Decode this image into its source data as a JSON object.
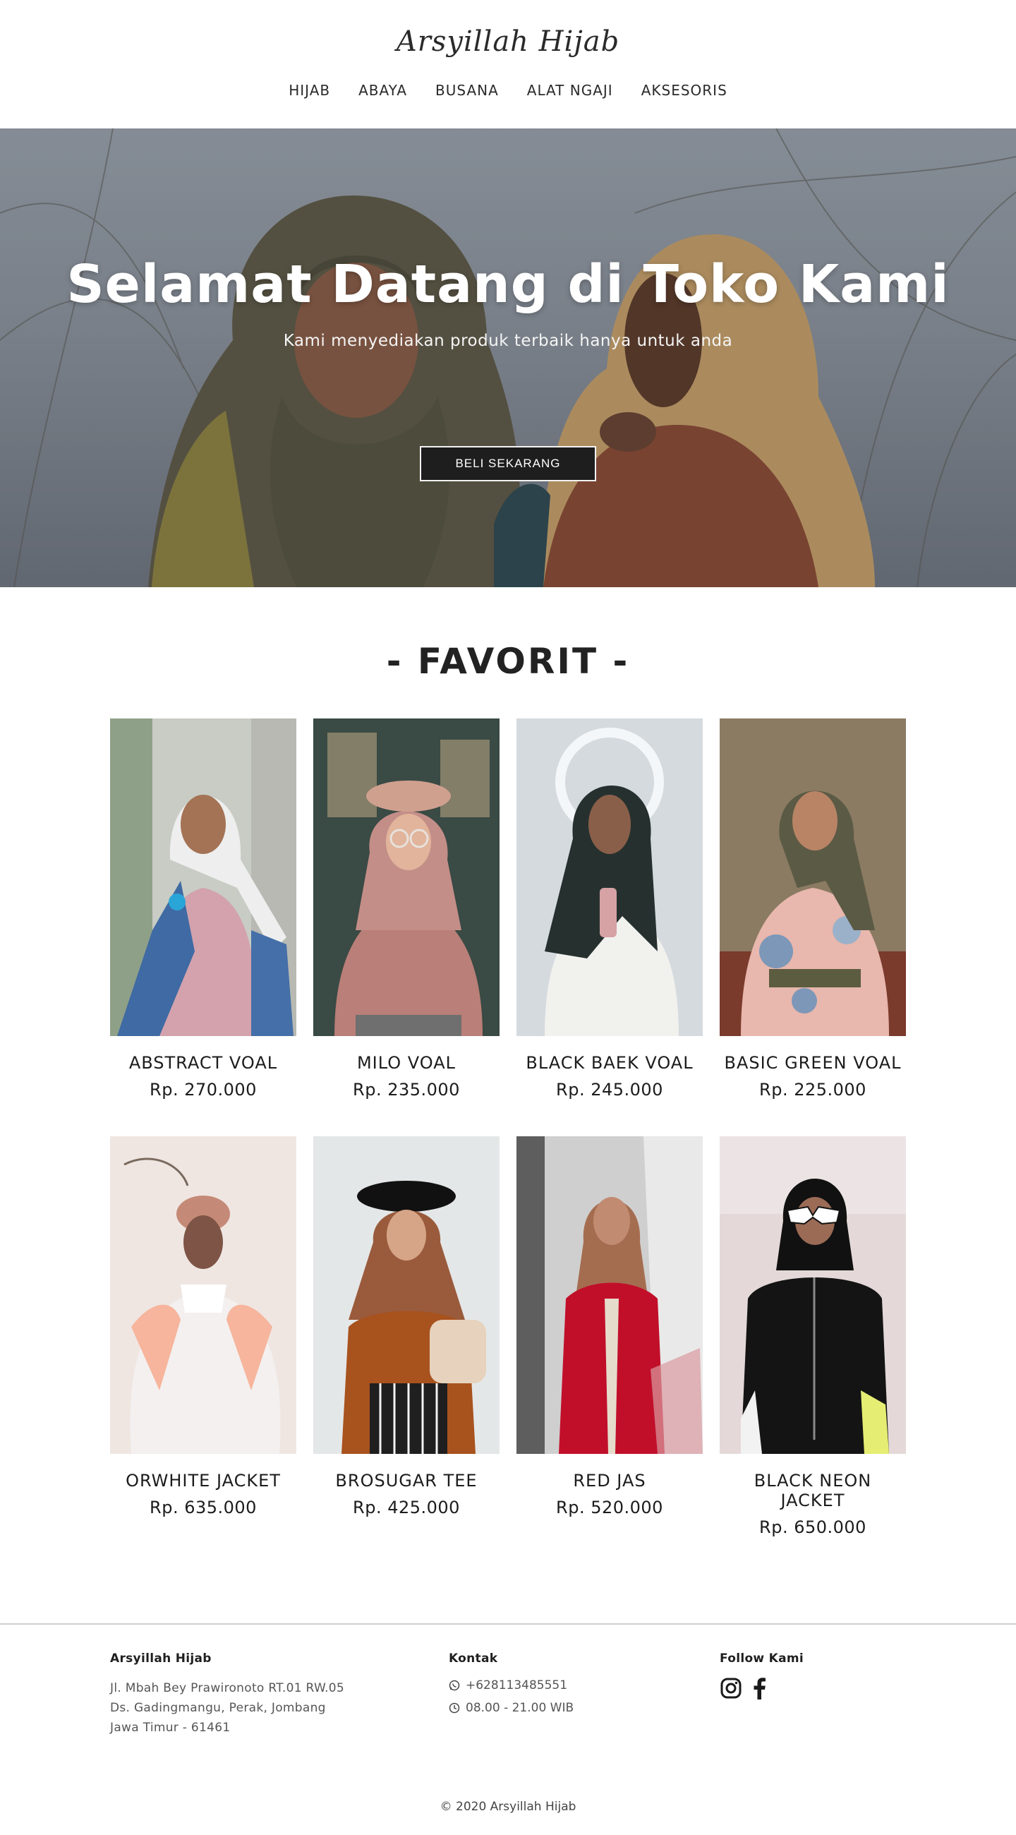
{
  "header": {
    "logo": "Arsyillah Hijab",
    "nav": [
      "HIJAB",
      "ABAYA",
      "BUSANA",
      "ALAT NGAJI",
      "AKSESORIS"
    ]
  },
  "hero": {
    "title": "Selamat Datang di Toko Kami",
    "subtitle": "Kami menyediakan produk terbaik hanya untuk anda",
    "button": "BELI SEKARANG"
  },
  "favorites": {
    "title": "- FAVORIT -",
    "products": [
      {
        "name": "ABSTRACT VOAL",
        "price": "Rp. 270.000"
      },
      {
        "name": "MILO VOAL",
        "price": "Rp. 235.000"
      },
      {
        "name": "BLACK BAEK VOAL",
        "price": "Rp. 245.000"
      },
      {
        "name": "BASIC GREEN VOAL",
        "price": "Rp. 225.000"
      },
      {
        "name": "ORWHITE JACKET",
        "price": "Rp. 635.000"
      },
      {
        "name": "BROSUGAR TEE",
        "price": "Rp. 425.000"
      },
      {
        "name": "RED JAS",
        "price": "Rp. 520.000"
      },
      {
        "name": "BLACK NEON JACKET",
        "price": "Rp. 650.000"
      }
    ]
  },
  "footer": {
    "store": {
      "title": "Arsyillah Hijab",
      "address": [
        "Jl. Mbah Bey Prawironoto RT.01 RW.05",
        "Ds. Gadingmangu, Perak, Jombang",
        "Jawa Timur - 61461"
      ]
    },
    "contact": {
      "title": "Kontak",
      "phone": "+628113485551",
      "hours": "08.00 - 21.00 WIB"
    },
    "follow": {
      "title": "Follow Kami",
      "icons": [
        "instagram-icon",
        "facebook-icon"
      ]
    },
    "copyright": "© 2020 Arsyillah Hijab"
  }
}
